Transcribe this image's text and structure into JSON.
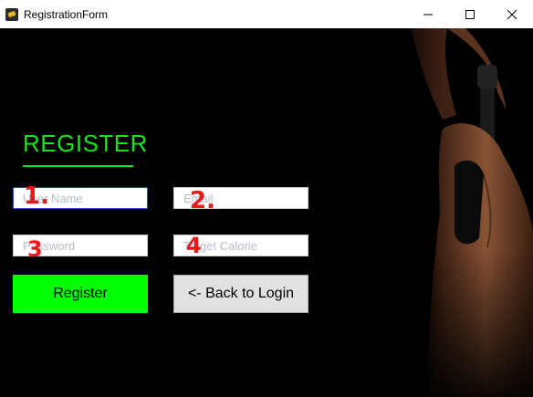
{
  "window": {
    "title": "RegistrationForm",
    "controls": [
      "minimize-icon",
      "maximize-icon",
      "close-icon"
    ]
  },
  "form": {
    "heading": "REGISTER",
    "fields": {
      "username_placeholder": "User Name",
      "email_placeholder": "Email",
      "password_placeholder": "Password",
      "calorie_placeholder": "Target Calorie"
    },
    "buttons": {
      "register_label": "Register",
      "back_label": "<- Back to Login"
    }
  },
  "annotations": [
    "1.",
    "2.",
    "3",
    "4"
  ],
  "colors": {
    "accent": "#19e319",
    "register_button": "#00ff00",
    "annotation": "#e31b1b",
    "background": "#000000"
  }
}
